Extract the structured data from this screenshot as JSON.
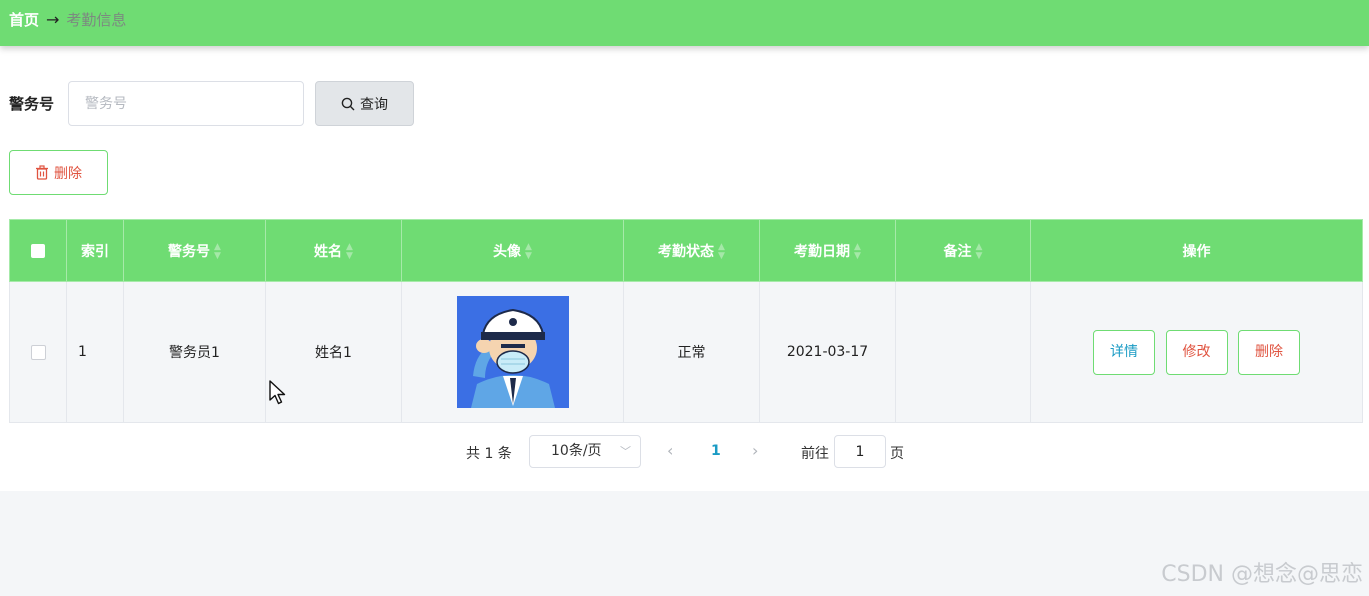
{
  "breadcrumb": {
    "home": "首页",
    "arrow": "→",
    "current": "考勤信息"
  },
  "search": {
    "label": "警务号",
    "placeholder": "警务号",
    "button_label": "查询"
  },
  "toolbar": {
    "delete_label": "删除"
  },
  "table": {
    "headers": {
      "index": "索引",
      "police_id": "警务号",
      "name": "姓名",
      "avatar": "头像",
      "status": "考勤状态",
      "date": "考勤日期",
      "remark": "备注",
      "actions": "操作"
    },
    "rows": [
      {
        "index": "1",
        "police_id": "警务员1",
        "name": "姓名1",
        "avatar_icon": "police-avatar-icon",
        "status": "正常",
        "date": "2021-03-17",
        "remark": "",
        "actions": {
          "detail": "详情",
          "edit": "修改",
          "delete": "删除"
        }
      }
    ]
  },
  "pagination": {
    "total_text": "共 1 条",
    "page_size": "10条/页",
    "current_page": "1",
    "goto_label": "前往",
    "goto_value": "1",
    "goto_unit": "页"
  },
  "watermark": "CSDN @想念@思恋",
  "colors": {
    "header_green": "#6fdc73",
    "link_blue": "#1a9bc4",
    "danger_red": "#e0533f"
  }
}
